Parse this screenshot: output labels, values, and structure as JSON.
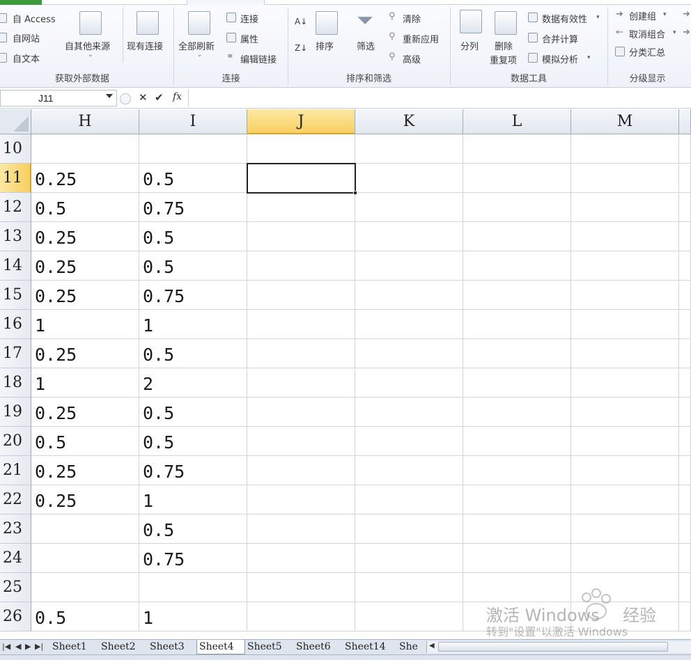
{
  "ribbon": {
    "groups": {
      "external_data": {
        "label": "获取外部数据",
        "from_access": "自 Access",
        "from_web": "自网站",
        "from_text": "自文本",
        "from_other": "自其他来源",
        "existing_conn": "现有连接"
      },
      "connections": {
        "label": "连接",
        "refresh_all": "全部刷新",
        "connections": "连接",
        "properties": "属性",
        "edit_links": "编辑链接"
      },
      "sort_filter": {
        "label": "排序和筛选",
        "sort": "排序",
        "filter": "筛选",
        "clear": "清除",
        "reapply": "重新应用",
        "advanced": "高级"
      },
      "data_tools": {
        "label": "数据工具",
        "text_to_columns": "分列",
        "remove_dup_line1": "删除",
        "remove_dup_line2": "重复项",
        "validation": "数据有效性",
        "consolidate": "合并计算",
        "what_if": "模拟分析"
      },
      "outline": {
        "label": "分级显示",
        "group": "创建组",
        "ungroup": "取消组合",
        "subtotal": "分类汇总"
      }
    }
  },
  "formula_bar": {
    "name_box": "J11",
    "cancel_glyph": "✕",
    "enter_glyph": "✔",
    "fx_glyph": "fx",
    "formula": ""
  },
  "sheet": {
    "columns": [
      "H",
      "I",
      "J",
      "K",
      "L",
      "M"
    ],
    "active_column": "J",
    "active_row": "11",
    "rows": [
      {
        "num": "10",
        "cells": [
          "",
          "",
          "",
          "",
          "",
          ""
        ]
      },
      {
        "num": "11",
        "cells": [
          "0.25",
          "0.5",
          "",
          "",
          "",
          ""
        ]
      },
      {
        "num": "12",
        "cells": [
          "0.5",
          "0.75",
          "",
          "",
          "",
          ""
        ]
      },
      {
        "num": "13",
        "cells": [
          "0.25",
          "0.5",
          "",
          "",
          "",
          ""
        ]
      },
      {
        "num": "14",
        "cells": [
          "0.25",
          "0.5",
          "",
          "",
          "",
          ""
        ]
      },
      {
        "num": "15",
        "cells": [
          "0.25",
          "0.75",
          "",
          "",
          "",
          ""
        ]
      },
      {
        "num": "16",
        "cells": [
          "1",
          "1",
          "",
          "",
          "",
          ""
        ]
      },
      {
        "num": "17",
        "cells": [
          "0.25",
          "0.5",
          "",
          "",
          "",
          ""
        ]
      },
      {
        "num": "18",
        "cells": [
          "1",
          "2",
          "",
          "",
          "",
          ""
        ]
      },
      {
        "num": "19",
        "cells": [
          "0.25",
          "0.5",
          "",
          "",
          "",
          ""
        ]
      },
      {
        "num": "20",
        "cells": [
          "0.5",
          "0.5",
          "",
          "",
          "",
          ""
        ]
      },
      {
        "num": "21",
        "cells": [
          "0.25",
          "0.75",
          "",
          "",
          "",
          ""
        ]
      },
      {
        "num": "22",
        "cells": [
          "0.25",
          "1",
          "",
          "",
          "",
          ""
        ]
      },
      {
        "num": "23",
        "cells": [
          "",
          "0.5",
          "",
          "",
          "",
          ""
        ]
      },
      {
        "num": "24",
        "cells": [
          "",
          "0.75",
          "",
          "",
          "",
          ""
        ]
      },
      {
        "num": "25",
        "cells": [
          "",
          "",
          "",
          "",
          "",
          ""
        ]
      },
      {
        "num": "26",
        "cells": [
          "0.5",
          "1",
          "",
          "",
          "",
          ""
        ]
      }
    ]
  },
  "sheet_tabs": {
    "tabs": [
      "Sheet1",
      "Sheet2",
      "Sheet3",
      "Sheet4",
      "Sheet5",
      "Sheet6",
      "Sheet14",
      "She"
    ],
    "active": "Sheet4"
  },
  "watermark": {
    "line1": "激活 Windows",
    "line2": "转到\"设置\"以激活 Windows",
    "brand": "经验"
  },
  "colors": {
    "active_header": "#f8cf60",
    "gridline": "#d4d4d4",
    "header_bg": "#e2e7ef",
    "excel_green": "#3c9a3a"
  }
}
